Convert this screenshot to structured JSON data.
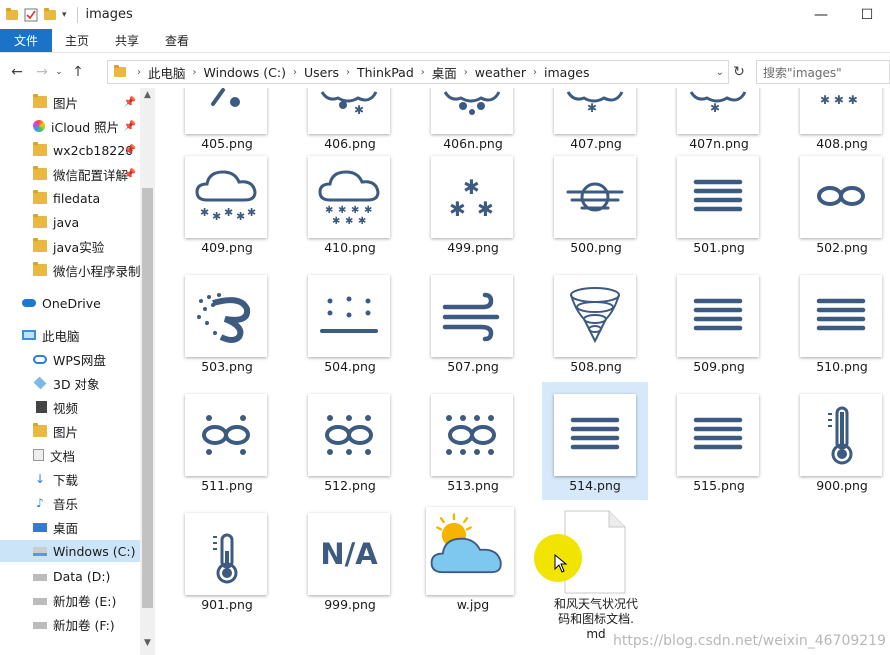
{
  "window": {
    "title": "images",
    "minimize": "—",
    "maximize": "☐"
  },
  "ribbon": {
    "tabs": [
      "文件",
      "主页",
      "共享",
      "查看"
    ]
  },
  "address": {
    "crumbs": [
      "此电脑",
      "Windows (C:)",
      "Users",
      "ThinkPad",
      "桌面",
      "weather",
      "images"
    ],
    "search_placeholder": "搜索\"images\""
  },
  "sidebar": {
    "items": [
      {
        "label": "图片",
        "pinned": true
      },
      {
        "label": "iCloud 照片",
        "pinned": true
      },
      {
        "label": "wx2cb18220",
        "pinned": true
      },
      {
        "label": "微信配置详解",
        "pinned": true
      },
      {
        "label": "filedata",
        "pinned": false
      },
      {
        "label": "java",
        "pinned": false
      },
      {
        "label": "java实验",
        "pinned": false
      },
      {
        "label": "微信小程序录制",
        "pinned": false
      },
      {
        "label": "OneDrive",
        "pinned": false
      },
      {
        "label": "此电脑",
        "pinned": false
      },
      {
        "label": "WPS网盘",
        "pinned": false
      },
      {
        "label": "3D 对象",
        "pinned": false
      },
      {
        "label": "视频",
        "pinned": false
      },
      {
        "label": "图片",
        "pinned": false
      },
      {
        "label": "文档",
        "pinned": false
      },
      {
        "label": "下载",
        "pinned": false
      },
      {
        "label": "音乐",
        "pinned": false
      },
      {
        "label": "桌面",
        "pinned": false
      },
      {
        "label": "Windows (C:)",
        "pinned": false
      },
      {
        "label": "Data (D:)",
        "pinned": false
      },
      {
        "label": "新加卷 (E:)",
        "pinned": false
      },
      {
        "label": "新加卷 (F:)",
        "pinned": false
      }
    ]
  },
  "files": {
    "row0": [
      "405.png",
      "406.png",
      "406n.png",
      "407.png",
      "407n.png",
      "408.png"
    ],
    "row1": [
      "409.png",
      "410.png",
      "499.png",
      "500.png",
      "501.png",
      "502.png"
    ],
    "row2": [
      "503.png",
      "504.png",
      "507.png",
      "508.png",
      "509.png",
      "510.png"
    ],
    "row3": [
      "511.png",
      "512.png",
      "513.png",
      "514.png",
      "515.png",
      "900.png"
    ],
    "row4": [
      "901.png",
      "999.png",
      "w.jpg"
    ],
    "md_name": "和风天气状况代码和图标文档.md",
    "md_lines": [
      "和风天气状况代",
      "码和图标文档.",
      "md"
    ],
    "na_text": "N/A"
  },
  "watermark": "https://blog.csdn.net/weixin_46709219",
  "icon_color": "#3d5a80"
}
